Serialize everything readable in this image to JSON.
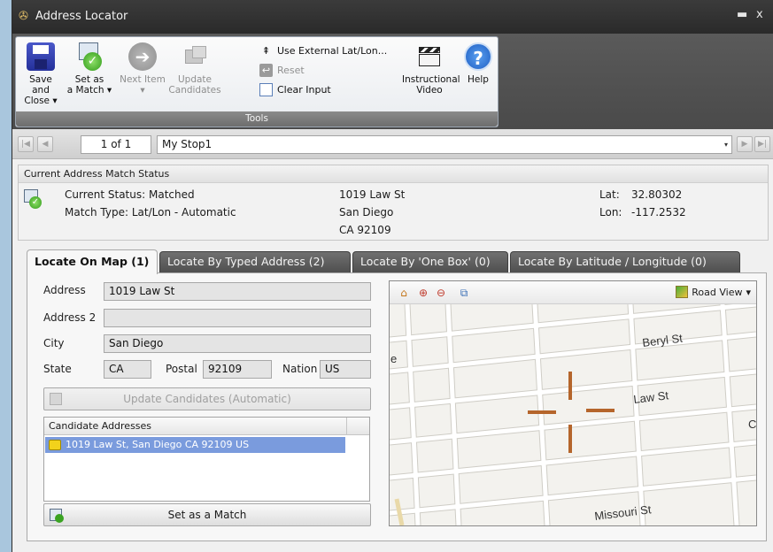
{
  "window": {
    "title": "Address Locator",
    "minimize_glyph": "▬",
    "close_glyph": "x"
  },
  "ribbon": {
    "buttons": [
      {
        "label_line1": "Save and",
        "label_line2": "Close ▾",
        "icon": "save-icon"
      },
      {
        "label_line1": "Set as",
        "label_line2": "a Match ▾",
        "icon": "match-icon"
      },
      {
        "label_line1": "Next Item",
        "label_line2": "▾",
        "icon": "next-arrow-icon"
      },
      {
        "label_line1": "Update",
        "label_line2": "Candidates",
        "icon": "update-candidates-icon"
      }
    ],
    "small_buttons": [
      {
        "label": "Use External Lat/Lon...",
        "icon": "external-latlon-icon"
      },
      {
        "label": "Reset",
        "icon": "reset-icon"
      },
      {
        "label": "Clear Input",
        "icon": "clear-input-icon"
      }
    ],
    "video": {
      "label_line1": "Instructional",
      "label_line2": "Video",
      "icon": "clapperboard-icon"
    },
    "help": {
      "label": "Help",
      "icon": "help-icon"
    },
    "group_label": "Tools"
  },
  "nav": {
    "pager": "1 of 1",
    "stop_name": "My Stop1",
    "dropdown_glyph": "▾"
  },
  "status": {
    "title": "Current Address Match Status",
    "current_status": "Current Status: Matched",
    "match_type": "Match Type: Lat/Lon - Automatic",
    "address_line1": "1019 Law St",
    "address_line2": "San Diego",
    "address_line3": "CA 92109",
    "lat_label": "Lat:",
    "lat_value": "32.80302",
    "lon_label": "Lon:",
    "lon_value": "-117.2532"
  },
  "tabs": [
    {
      "label": "Locate On Map (1)"
    },
    {
      "label": "Locate By Typed Address (2)"
    },
    {
      "label": "Locate By 'One Box' (0)"
    },
    {
      "label": "Locate By Latitude / Longitude (0)"
    }
  ],
  "form": {
    "address_label": "Address",
    "address_value": "1019 Law St",
    "address2_label": "Address 2",
    "address2_value": "",
    "city_label": "City",
    "city_value": "San Diego",
    "state_label": "State",
    "state_value": "CA",
    "postal_label": "Postal",
    "postal_value": "92109",
    "nation_label": "Nation",
    "nation_value": "US",
    "update_button": "Update Candidates (Automatic)",
    "candidates_header": "Candidate Addresses",
    "candidates": [
      "1019 Law St, San Diego CA 92109 US"
    ],
    "set_match_button": "Set as a Match"
  },
  "map": {
    "view_label": "Road View",
    "view_dropdown_glyph": "▾",
    "streets": [
      "Beryl St",
      "Law St",
      "Missouri St"
    ],
    "edge_labels": [
      "e",
      "C"
    ],
    "marker_color": "#b5652b"
  },
  "colors": {
    "selection": "#7a9bdd",
    "title_bar": "#2f2f2f",
    "ribbon_group": "#6f6f6f"
  }
}
